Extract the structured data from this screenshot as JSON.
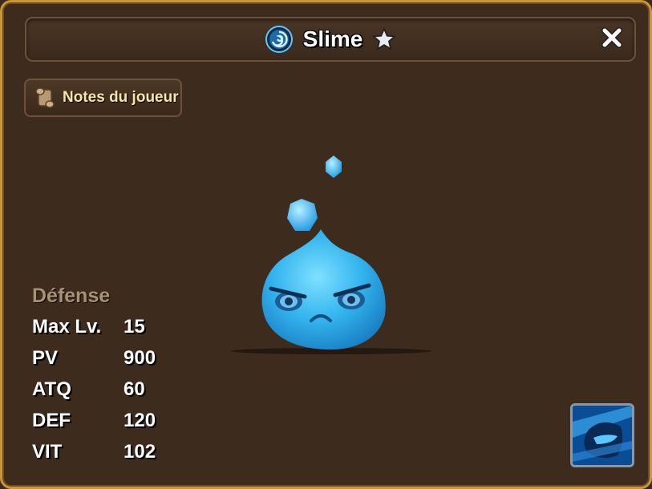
{
  "header": {
    "title": "Slime",
    "element_icon": "water-swirl-icon",
    "star_icon": "star-icon",
    "close_icon": "close-icon"
  },
  "notes_button": {
    "label": "Notes du joueur",
    "icon": "scroll-icon"
  },
  "stats": {
    "type": "Défense",
    "rows": [
      {
        "label": "Max Lv.",
        "value": "15"
      },
      {
        "label": "PV",
        "value": "900"
      },
      {
        "label": "ATQ",
        "value": "60"
      },
      {
        "label": "DEF",
        "value": "120"
      },
      {
        "label": "VIT",
        "value": "102"
      }
    ]
  },
  "skill": {
    "icon": "skill-icon"
  },
  "colors": {
    "frame_gold": "#c9963c",
    "panel_brown": "#3d2b1d",
    "notes_text": "#f6e7a8",
    "stat_type": "#a99174",
    "slime_blue": "#35b6f0"
  }
}
